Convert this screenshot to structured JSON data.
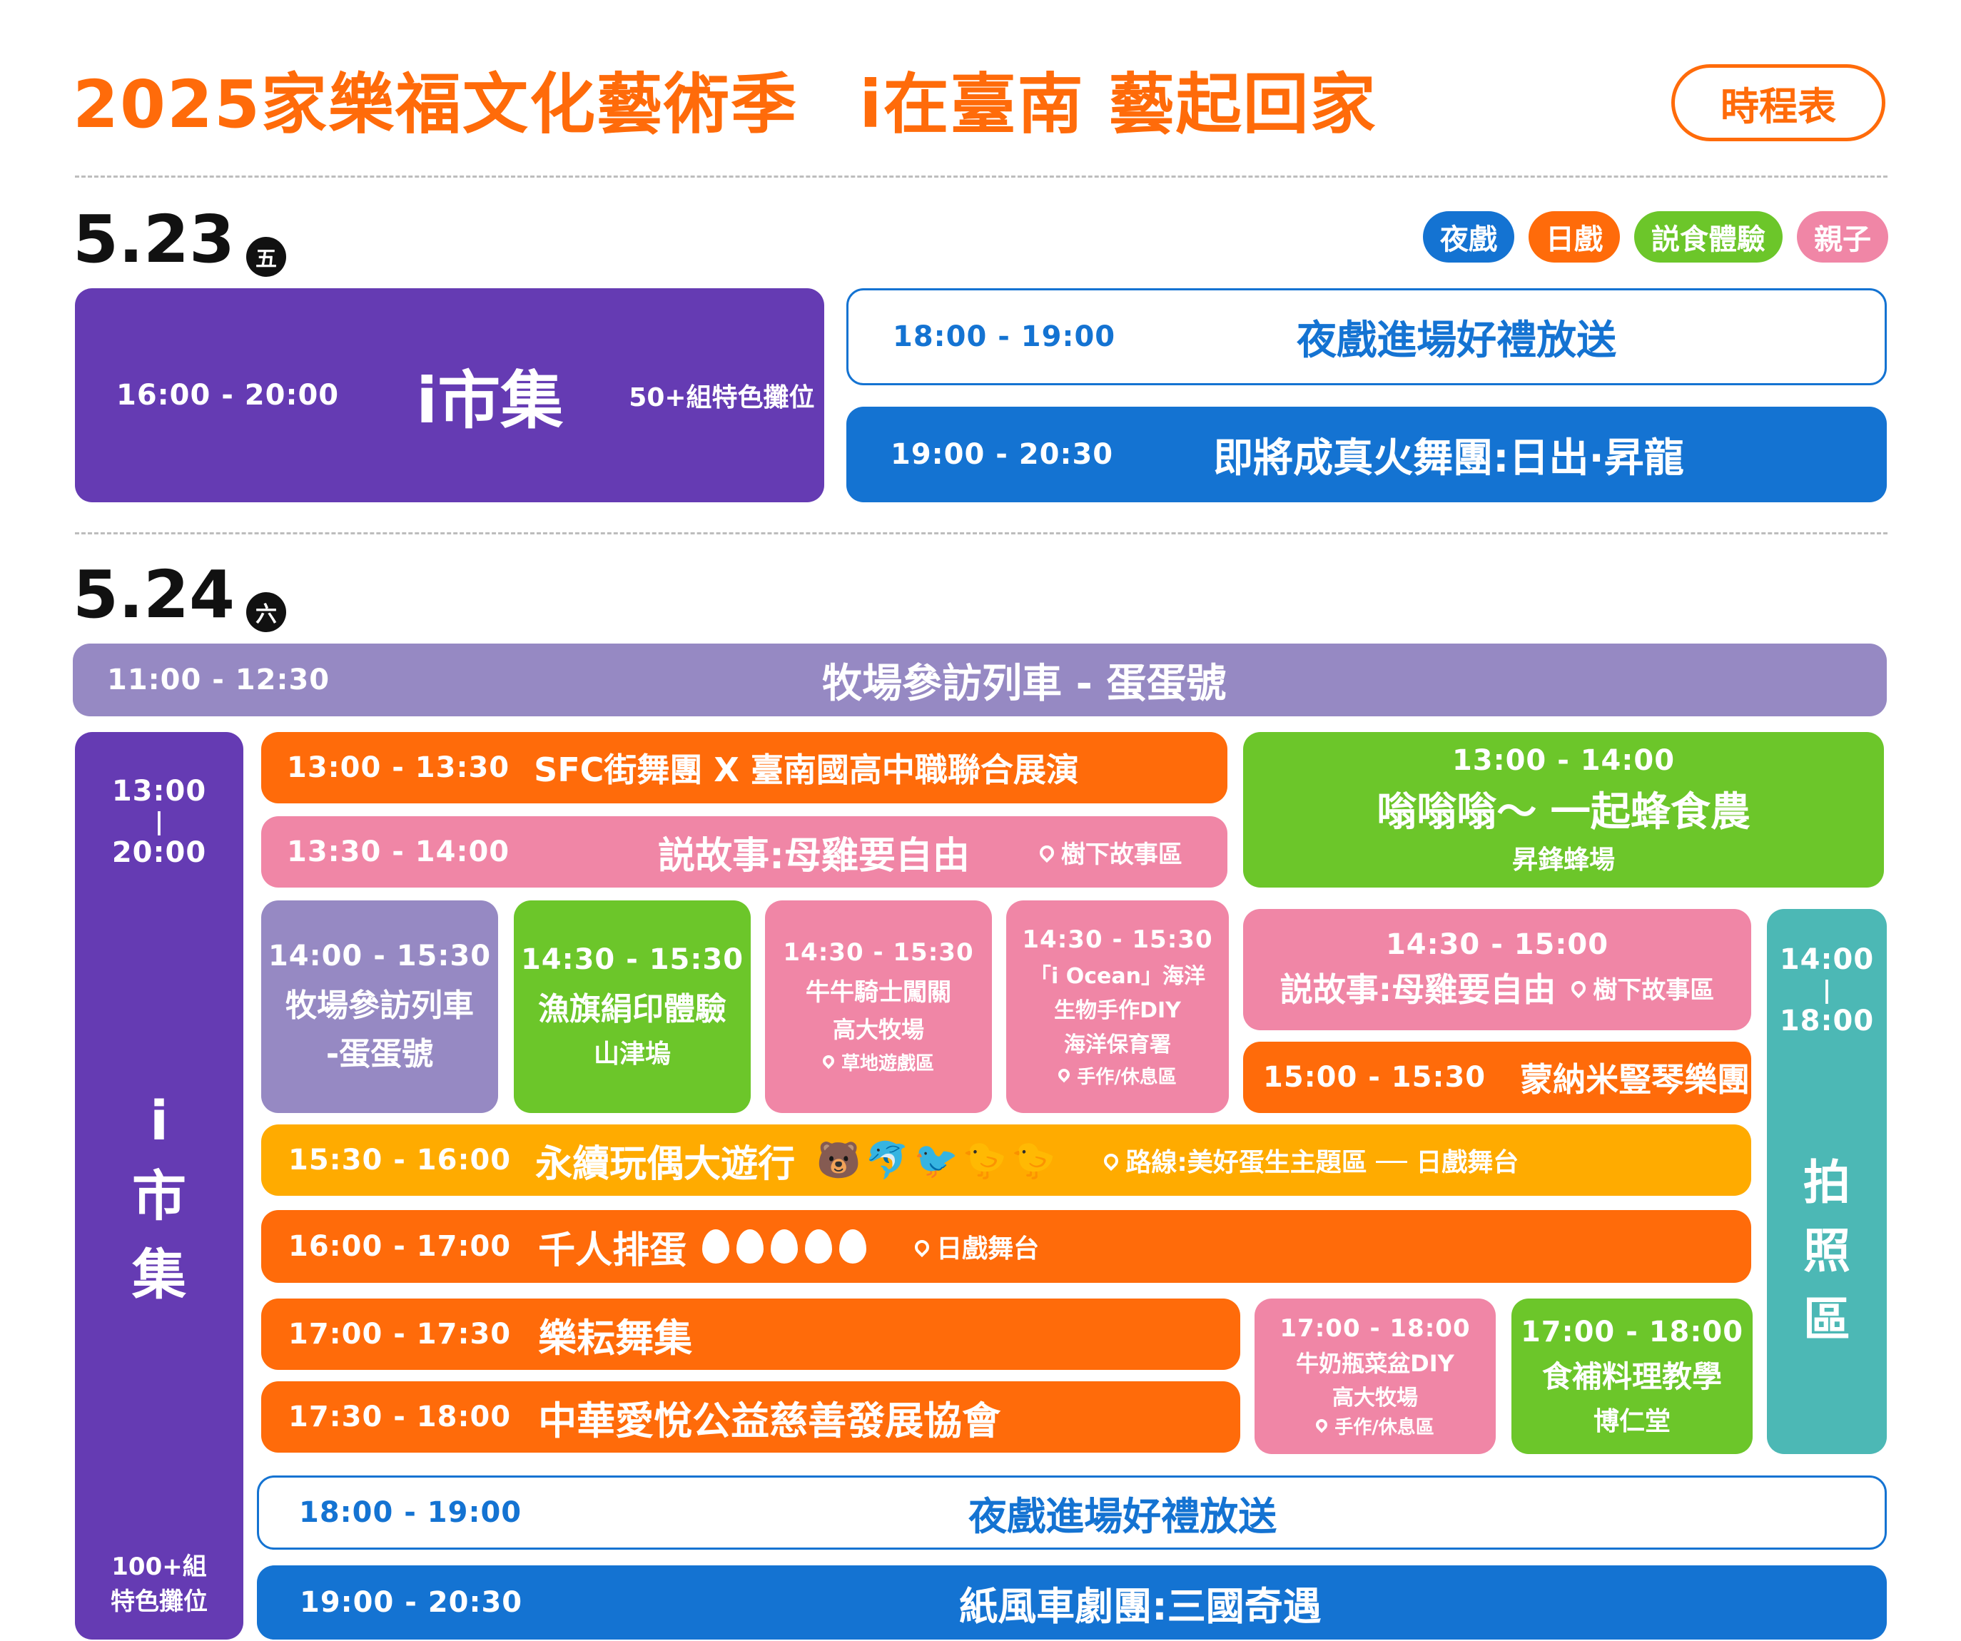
{
  "header": {
    "title": "2025家樂福文化藝術季",
    "slogan": "i在臺南 藝起回家",
    "badge": "時程表"
  },
  "colors": {
    "orange": "#FF6B0A",
    "purple": "#653BB3",
    "lavender": "#9689C3",
    "blue": "#1473D2",
    "green": "#6CC62A",
    "pink": "#F086A6",
    "amber": "#FFAB00",
    "teal": "#4CB8B5"
  },
  "legend": [
    "夜戲",
    "日戲",
    "説食體驗",
    "親子"
  ],
  "day1": {
    "date": "5.23",
    "weekday": "五",
    "market": {
      "time": "16:00 - 20:00",
      "title": "i市集",
      "note": "50+組特色攤位"
    },
    "gift": {
      "time": "18:00 - 19:00",
      "title": "夜戲進場好禮放送"
    },
    "night": {
      "time": "19:00 - 20:30",
      "title": "即將成真火舞團:日出·昇龍"
    }
  },
  "day2": {
    "date": "5.24",
    "weekday": "六",
    "train": {
      "time": "11:00 - 12:30",
      "title": "牧場參訪列車 - 蛋蛋號"
    },
    "market": {
      "time_start": "13:00",
      "time_sep": "|",
      "time_end": "20:00",
      "title_1": "i",
      "title_2": "市",
      "title_3": "集",
      "note_1": "100+組",
      "note_2": "特色攤位"
    },
    "sfc": {
      "time": "13:00 - 13:30",
      "title": "SFC街舞團 X 臺南國高中職聯合展演"
    },
    "story1": {
      "time": "13:30 - 14:00",
      "title": "説故事:母雞要自由",
      "location": "樹下故事區"
    },
    "bee": {
      "time": "13:00 - 14:00",
      "title": "嗡嗡嗡～ 一起蜂食農",
      "sub": "昇鋒蜂場"
    },
    "train2": {
      "time": "14:00 - 15:30",
      "title_1": "牧場參訪列車",
      "title_2": "-蛋蛋號"
    },
    "flag": {
      "time": "14:30 - 15:30",
      "title": "漁旗絹印體驗",
      "sub": "山津塢"
    },
    "knight": {
      "time": "14:30 - 15:30",
      "title": "牛牛騎士闖關",
      "sub": "高大牧場",
      "location": "草地遊戲區"
    },
    "ocean": {
      "time": "14:30 - 15:30",
      "title_1": "「i Ocean」海洋",
      "title_2": "生物手作DIY",
      "sub": "海洋保育署",
      "location": "手作/休息區"
    },
    "story2": {
      "time": "14:30 - 15:00",
      "title": "説故事:母雞要自由",
      "location": "樹下故事區"
    },
    "harp": {
      "time": "15:00 - 15:30",
      "title": "蒙納米豎琴樂團"
    },
    "parade": {
      "time": "15:30 - 16:00",
      "title": "永續玩偶大遊行",
      "location": "路線:美好蛋生主題區 ── 日戲舞台"
    },
    "eggs": {
      "time": "16:00 - 17:00",
      "title": "千人排蛋",
      "location": "日戲舞台"
    },
    "dance": {
      "time": "17:00 - 17:30",
      "title": "樂耘舞集"
    },
    "charity": {
      "time": "17:30 - 18:00",
      "title": "中華愛悅公益慈善發展協會"
    },
    "bottle": {
      "time": "17:00 - 18:00",
      "title": "牛奶瓶菜盆DIY",
      "sub": "高大牧場",
      "location": "手作/休息區"
    },
    "cook": {
      "time": "17:00 - 18:00",
      "title": "食補料理教學",
      "sub": "博仁堂"
    },
    "photo": {
      "time_start": "14:00",
      "time_sep": "|",
      "time_end": "18:00",
      "title_1": "拍",
      "title_2": "照",
      "title_3": "區"
    },
    "gift": {
      "time": "18:00 - 19:00",
      "title": "夜戲進場好禮放送"
    },
    "night": {
      "time": "19:00 - 20:30",
      "title": "紙風車劇團:三國奇遇"
    }
  }
}
